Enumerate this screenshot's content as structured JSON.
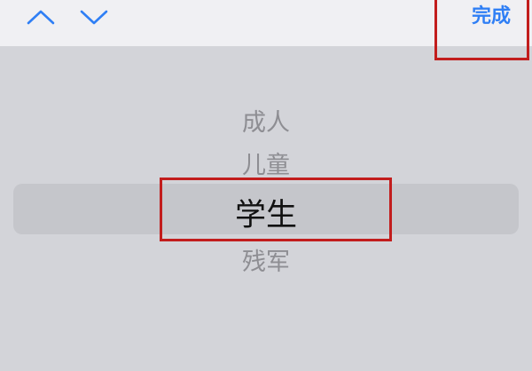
{
  "toolbar": {
    "prev_icon": "chevron-up-icon",
    "next_icon": "chevron-down-icon",
    "done_label": "完成",
    "accent_color": "#2f7ff5"
  },
  "picker": {
    "options": [
      "成人",
      "儿童",
      "学生",
      "残军"
    ],
    "selected_index": 2,
    "selected_value": "学生"
  },
  "annotations": {
    "highlight_color": "#c21d1d"
  }
}
